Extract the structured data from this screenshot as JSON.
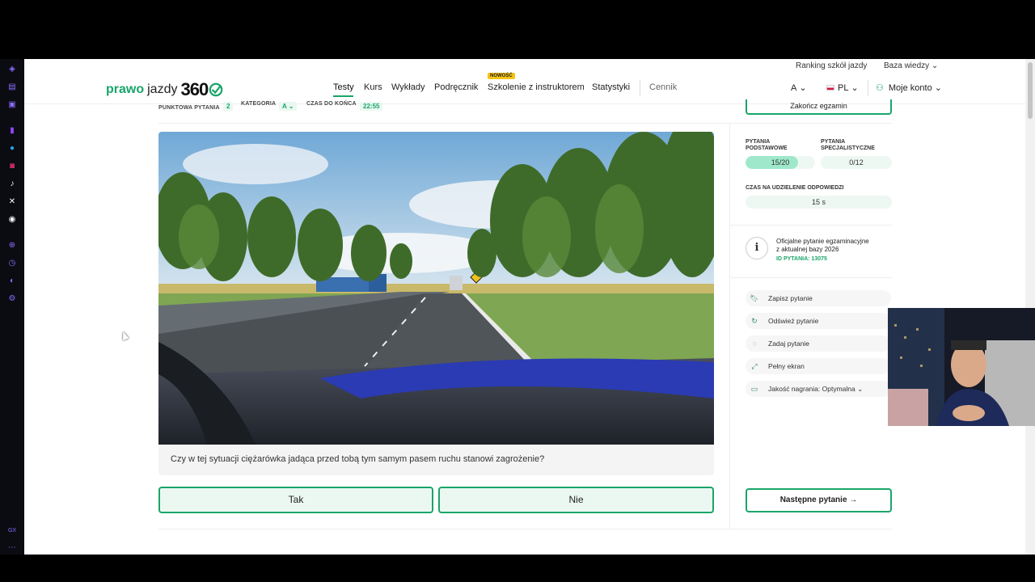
{
  "header": {
    "top_links": [
      "Ranking szkół jazdy",
      "Baza wiedzy"
    ],
    "logo": {
      "part1": "prawo",
      "part2": "jazdy",
      "part3": "360"
    },
    "nav": [
      "Testy",
      "Kurs",
      "Wykłady",
      "Podręcznik",
      "Szkolenie z instruktorem",
      "Statystyki",
      "Cennik"
    ],
    "new_badge": "NOWOŚĆ",
    "category_select": "A",
    "language": "PL",
    "account": "Moje konto"
  },
  "exam_meta": {
    "points_label": "PUNKTOWA PYTANIA",
    "points_value": "2",
    "category_label": "KATEGORIA",
    "category_value": "A",
    "time_label": "CZAS DO KOŃCA",
    "time_value": "22:55",
    "end_button": "Zakończ egzamin"
  },
  "question": {
    "text": "Czy w tej sytuacji ciężarówka jadąca przed tobą tym samym pasem ruchu stanowi zagrożenie?",
    "answers": [
      "Tak",
      "Nie"
    ]
  },
  "progress": {
    "basic_label": "PYTANIA PODSTAWOWE",
    "basic_value": "15/20",
    "basic_fraction": 0.75,
    "special_label": "PYTANIA SPECJALISTYCZNE",
    "special_value": "0/12",
    "time_label": "CZAS NA UDZIELENIE ODPOWIEDZI",
    "time_value": "15 s"
  },
  "info": {
    "line1": "Oficjalne pytanie egzaminacyjne",
    "line2": "z aktualnej bazy 2026",
    "id": "ID PYTANIA: 13075"
  },
  "actions": [
    "Zapisz pytanie",
    "Odśwież pytanie",
    "Zadaj pytanie",
    "Pełny ekran",
    "Jakość nagrania: Optymalna"
  ],
  "next_button": "Następne pytanie",
  "sidebar_footer": "GX",
  "colors": {
    "accent": "#1aa56a",
    "badge": "#f5c518"
  }
}
